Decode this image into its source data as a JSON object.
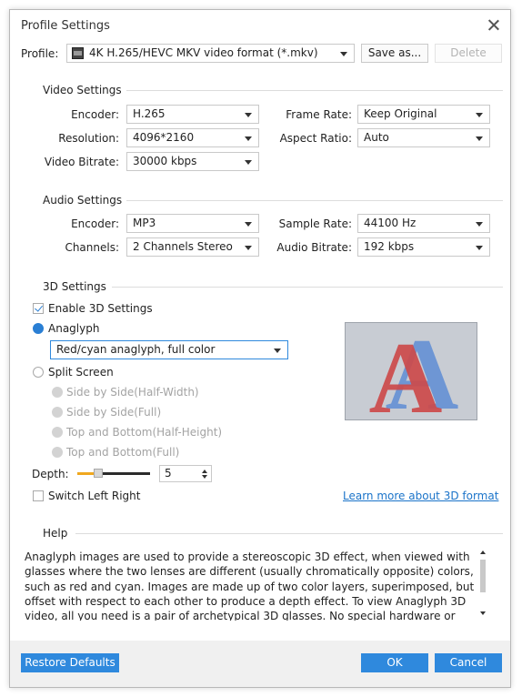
{
  "window": {
    "title": "Profile Settings"
  },
  "profile": {
    "label": "Profile:",
    "value": "4K H.265/HEVC MKV video format (*.mkv)",
    "icon": "mkv-file-icon",
    "save_as": "Save as...",
    "delete": "Delete"
  },
  "video": {
    "title": "Video Settings",
    "encoder_label": "Encoder:",
    "encoder": "H.265",
    "resolution_label": "Resolution:",
    "resolution": "4096*2160",
    "bitrate_label": "Video Bitrate:",
    "bitrate": "30000 kbps",
    "framerate_label": "Frame Rate:",
    "framerate": "Keep Original",
    "aspect_label": "Aspect Ratio:",
    "aspect": "Auto"
  },
  "audio": {
    "title": "Audio Settings",
    "encoder_label": "Encoder:",
    "encoder": "MP3",
    "channels_label": "Channels:",
    "channels": "2 Channels Stereo",
    "samplerate_label": "Sample Rate:",
    "samplerate": "44100 Hz",
    "bitrate_label": "Audio Bitrate:",
    "bitrate": "192 kbps"
  },
  "three_d": {
    "title": "3D Settings",
    "enable_label": "Enable 3D Settings",
    "enable_checked": true,
    "anaglyph_label": "Anaglyph",
    "anaglyph_value": "Red/cyan anaglyph, full color",
    "split_label": "Split Screen",
    "sbs_half": "Side by Side(Half-Width)",
    "sbs_full": "Side by Side(Full)",
    "tb_half": "Top and Bottom(Half-Height)",
    "tb_full": "Top and Bottom(Full)",
    "depth_label": "Depth:",
    "depth_value": "5",
    "depth_fraction": 0.25,
    "switch_label": "Switch Left Right",
    "switch_checked": false,
    "learn_more": "Learn more about 3D format",
    "preview_letter": "A",
    "colors": {
      "accent": "#2f89dd",
      "slider": "#f0a81f",
      "red": "#cc4a4a",
      "cyan": "#6e96d4"
    }
  },
  "help": {
    "title": "Help",
    "text": "Anaglyph images are used to provide a stereoscopic 3D effect, when viewed with glasses where the two lenses are different (usually chromatically opposite) colors, such as red and cyan. Images are made up of two color layers, superimposed, but offset with respect to each other to produce a depth effect. To view Anaglyph 3D video, all you need is a pair of archetypical 3D glasses. No special hardware or"
  },
  "footer": {
    "restore": "Restore Defaults",
    "ok": "OK",
    "cancel": "Cancel"
  }
}
